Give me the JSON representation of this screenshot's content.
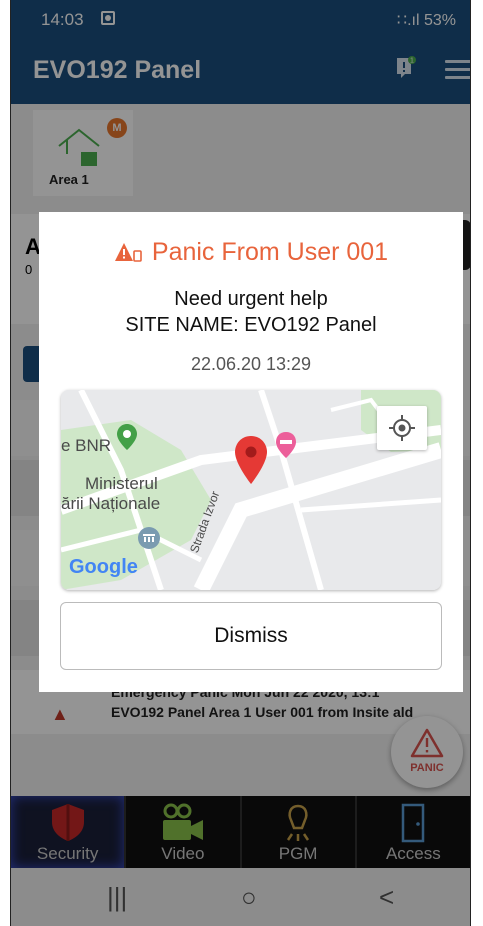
{
  "status_bar": {
    "time": "14:03",
    "signal_battery": "∷.ıl 53%"
  },
  "header": {
    "title": "EVO192 Panel",
    "notification_badge": "1"
  },
  "areas": {
    "tab_label": "Area 1",
    "tab_badge": "M"
  },
  "background": {
    "row_big": "A",
    "row_small": "0",
    "event_line1": "Emergency Panic Mon Jun 22 2020, 13:1",
    "event_line2": "EVO192 Panel Area 1 User 001 from Insite  ald"
  },
  "panic_button": {
    "label": "PANIC"
  },
  "dialog": {
    "title": "Panic From User 001",
    "message_line1": "Need urgent help",
    "message_line2": "SITE NAME: EVO192 Panel",
    "timestamp": "22.06.20 13:29",
    "map": {
      "label_bnr": "e BNR",
      "label_ministerul": "Ministerul",
      "label_arii": "ării Naționale",
      "label_street": "Strada Izvor",
      "google_logo": "Google"
    },
    "dismiss_label": "Dismiss"
  },
  "bottom_nav": {
    "items": [
      {
        "label": "Security",
        "icon": "shield-icon"
      },
      {
        "label": "Video",
        "icon": "video-camera-icon"
      },
      {
        "label": "PGM",
        "icon": "bulb-icon"
      },
      {
        "label": "Access",
        "icon": "door-icon"
      }
    ]
  },
  "system_nav": {
    "recents": "|||",
    "home": "○",
    "back": "<"
  },
  "colors": {
    "header": "#1b4f7e",
    "alert": "#e8643c",
    "shield": "#c62828"
  }
}
